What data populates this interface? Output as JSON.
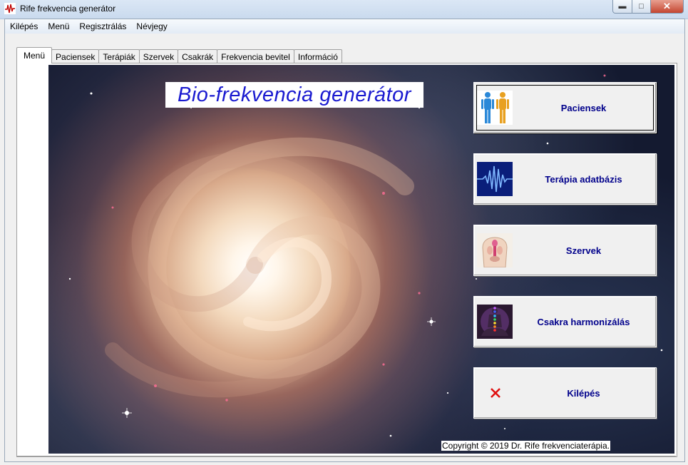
{
  "window": {
    "title": "Rife frekvencia generátor"
  },
  "menubar": [
    "Kilépés",
    "Menü",
    "Regisztrálás",
    "Névjegy"
  ],
  "tabs": [
    {
      "label": "Menü",
      "active": true
    },
    {
      "label": "Paciensek"
    },
    {
      "label": "Terápiák"
    },
    {
      "label": "Szervek"
    },
    {
      "label": "Csakrák"
    },
    {
      "label": "Frekvencia bevitel"
    },
    {
      "label": "Információ"
    }
  ],
  "main": {
    "banner": "Bio-frekvencia generátor",
    "buttons": [
      {
        "label": "Paciensek",
        "icon": "patients-figures-icon"
      },
      {
        "label": "Terápia adatbázis",
        "icon": "frequency-wave-icon"
      },
      {
        "label": "Szervek",
        "icon": "organs-body-icon"
      },
      {
        "label": "Csakra harmonizálás",
        "icon": "chakra-meditation-icon"
      },
      {
        "label": "Kilépés",
        "icon": "red-x-icon"
      }
    ],
    "copyright": "Copyright © 2019 Dr. Rife frekvenciaterápia."
  },
  "colors": {
    "banner_text": "#1a1ad0",
    "button_text": "#00008b",
    "exit_x": "#e01010"
  }
}
